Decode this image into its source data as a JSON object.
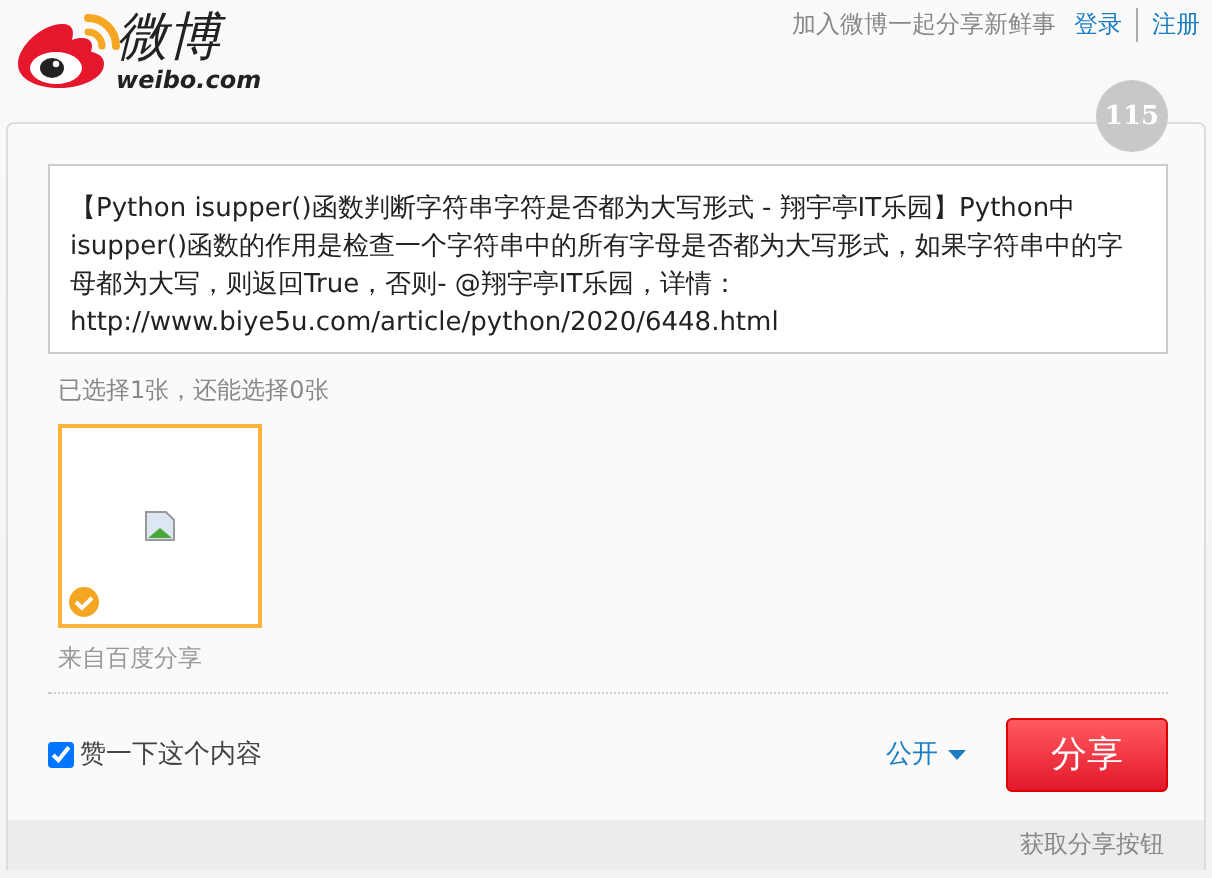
{
  "header": {
    "logo_text": "微博",
    "logo_domain": "weibo.com",
    "tagline": "加入微博一起分享新鲜事",
    "links": [
      "登录",
      "注册"
    ]
  },
  "share": {
    "counter": "115",
    "text": "【Python isupper()函数判断字符串字符是否都为大写形式 - 翔宇亭IT乐园】Python中isupper()函数的作用是检查一个字符串中的所有字母是否都为大写形式，如果字符串中的字母都为大写，则返回True，否则- @翔宇亭IT乐园，详情：http://www.biye5u.com/article/python/2020/6448.html",
    "selection_info": "已选择1张，还能选择0张",
    "images": [
      {
        "kind": "picture",
        "selected": true
      }
    ],
    "source": "来自百度分享",
    "like": {
      "label": "赞一下这个内容",
      "checked": true
    },
    "visibility": "公开",
    "share_button": "分享"
  },
  "footer": {
    "link": "获取分享按钮"
  }
}
